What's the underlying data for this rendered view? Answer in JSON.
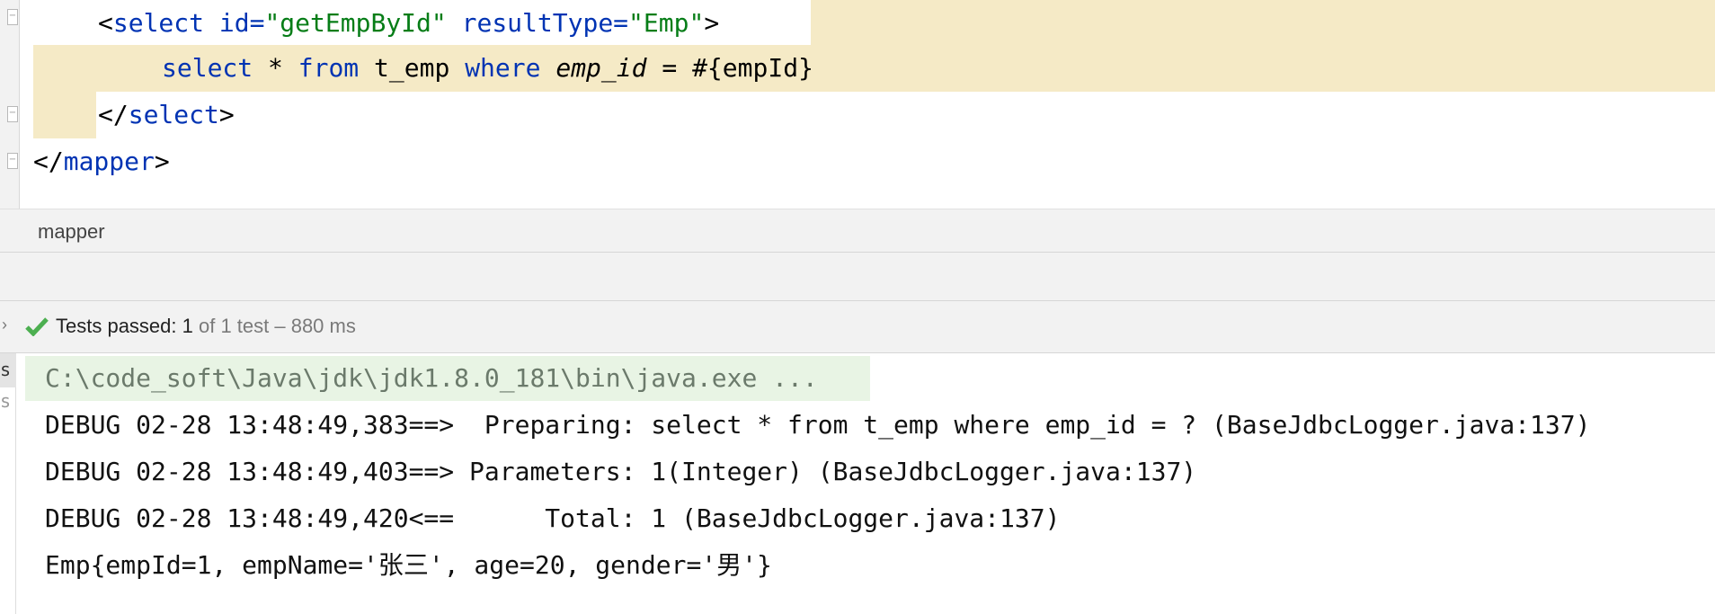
{
  "editor": {
    "line1": {
      "open": "<",
      "tag": "select",
      "attr1": "id=",
      "val1": "\"getEmpById\"",
      "attr2": "resultType=",
      "val2": "\"Emp\"",
      "close": ">"
    },
    "line2": {
      "kw1": "select",
      "star": " * ",
      "kw2": "from",
      "t1": " t_emp ",
      "kw3": "where",
      "col": "emp_id",
      "rest": " = #{empId}"
    },
    "line3": {
      "open": "</",
      "tag": "select",
      "close": ">"
    },
    "line4": {
      "open": "</",
      "tag": "mapper",
      "close": ">"
    }
  },
  "breadcrumb": "mapper",
  "tests": {
    "passed": "Tests passed: 1",
    "detail": " of 1 test – 880 ms",
    "icon": "check-icon",
    "color": "#4caf50"
  },
  "side_tabs": [
    "s",
    "s"
  ],
  "console": {
    "lines": [
      "C:\\code_soft\\Java\\jdk\\jdk1.8.0_181\\bin\\java.exe ...",
      "DEBUG 02-28 13:48:49,383==>  Preparing: select * from t_emp where emp_id = ? (BaseJdbcLogger.java:137)",
      "DEBUG 02-28 13:48:49,403==> Parameters: 1(Integer) (BaseJdbcLogger.java:137)",
      "DEBUG 02-28 13:48:49,420<==      Total: 1 (BaseJdbcLogger.java:137)",
      "Emp{empId=1, empName='张三', age=20, gender='男'}"
    ]
  }
}
